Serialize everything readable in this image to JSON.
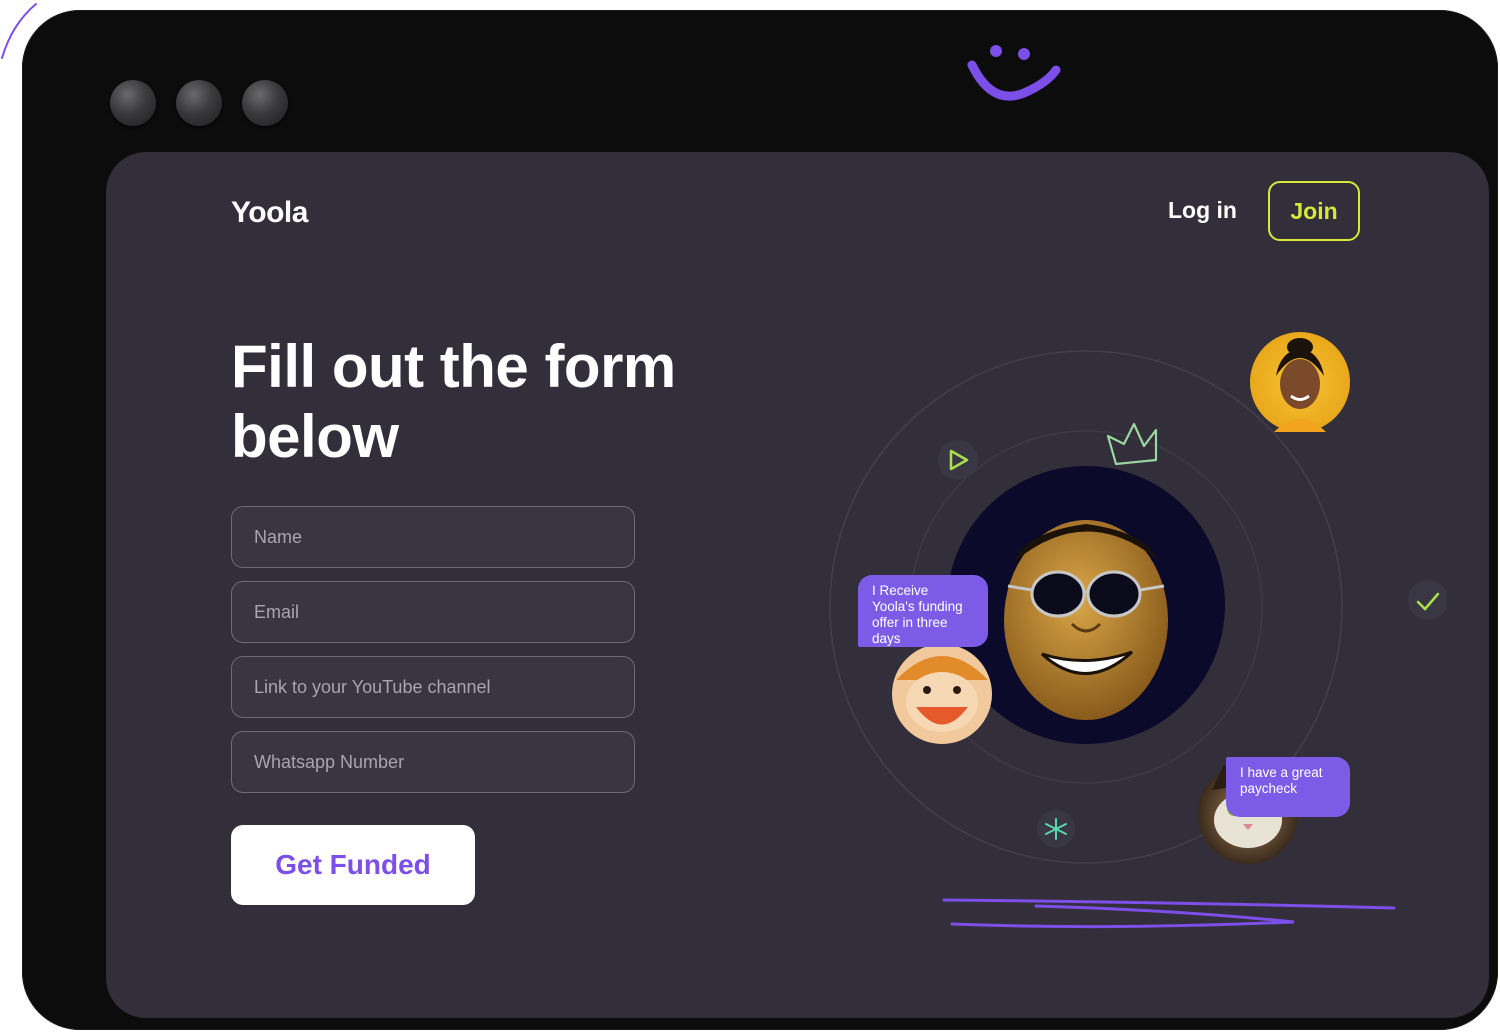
{
  "brand": {
    "logo_text": "Yoola"
  },
  "nav": {
    "login_label": "Log in",
    "join_label": "Join"
  },
  "hero": {
    "heading": "Fill out the form below"
  },
  "form": {
    "name_placeholder": "Name",
    "email_placeholder": "Email",
    "youtube_placeholder": "Link to your YouTube channel",
    "whatsapp_placeholder": "Whatsapp Number",
    "submit_label": "Get Funded"
  },
  "illustration": {
    "bubble_funding": "I Receive Yoola's funding offer in three days",
    "bubble_paycheck": "I have a great paycheck"
  },
  "icons": [
    "window-dot-icon",
    "smiley-icon",
    "play-icon",
    "crown-icon",
    "check-icon",
    "sparkle-icon",
    "scribble-decoration"
  ],
  "colors": {
    "accent_purple": "#7b4fe8",
    "join_lime": "#d4e93a",
    "screen_bg": "#322e3a",
    "frame_bg": "#0c0c0d"
  }
}
